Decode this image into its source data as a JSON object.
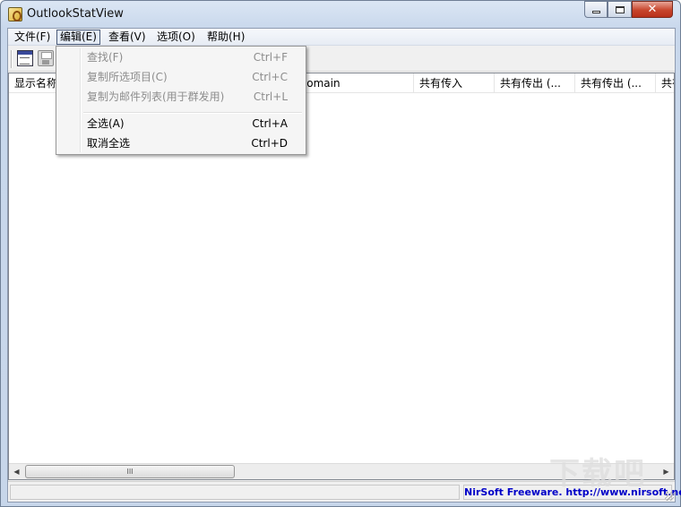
{
  "window": {
    "title": "OutlookStatView"
  },
  "menubar": {
    "items": [
      {
        "label": "文件(F)"
      },
      {
        "label": "编辑(E)"
      },
      {
        "label": "查看(V)"
      },
      {
        "label": "选项(O)"
      },
      {
        "label": "帮助(H)"
      }
    ]
  },
  "edit_menu": {
    "items": [
      {
        "label": "查找(F)",
        "shortcut": "Ctrl+F",
        "enabled": false
      },
      {
        "label": "复制所选项目(C)",
        "shortcut": "Ctrl+C",
        "enabled": false
      },
      {
        "label": "复制为邮件列表(用于群发用)",
        "shortcut": "Ctrl+L",
        "enabled": false
      },
      {
        "label": "全选(A)",
        "shortcut": "Ctrl+A",
        "enabled": true
      },
      {
        "label": "取消全选",
        "shortcut": "Ctrl+D",
        "enabled": true
      }
    ]
  },
  "list": {
    "columns": [
      {
        "label": "显示名称"
      },
      {
        "label": "Domain"
      },
      {
        "label": "共有传入"
      },
      {
        "label": "共有传出 (..."
      },
      {
        "label": "共有传出 (..."
      },
      {
        "label": "共有"
      }
    ],
    "rows": []
  },
  "scrollbar": {
    "thumb_grip": "III"
  },
  "statusbar": {
    "left_text": "",
    "link_text": "NirSoft Freeware.  http://www.nirsoft.net"
  },
  "watermark": {
    "text": "下载吧"
  },
  "colors": {
    "link": "#0000c8",
    "close_button": "#c7452c"
  }
}
